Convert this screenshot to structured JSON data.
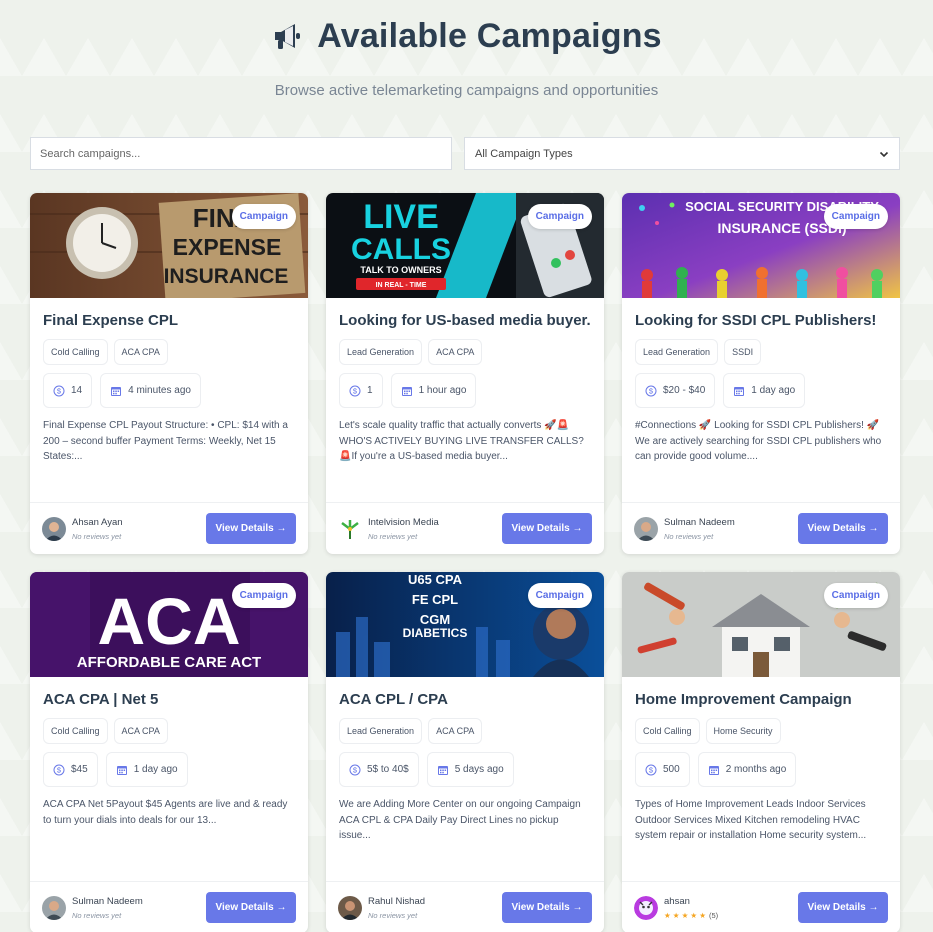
{
  "header": {
    "title": "Available Campaigns",
    "subtitle": "Browse active telemarketing campaigns and opportunities"
  },
  "filters": {
    "search_placeholder": "Search campaigns...",
    "type_selected": "All Campaign Types"
  },
  "colors": {
    "accent": "#6878e8",
    "title": "#2c3e50"
  },
  "campaigns": [
    {
      "badge": "Campaign",
      "banner_text": [
        "FINAL",
        "EXPENSE",
        "INSURANCE"
      ],
      "title": "Final Expense CPL",
      "tags": [
        "Cold Calling",
        "ACA CPA"
      ],
      "payout": "14",
      "posted": "4 minutes ago",
      "description": "Final Expense CPL Payout Structure: • CPL: $14 with a 200 – second buffer Payment Terms: Weekly, Net 15 States:...",
      "author": "Ahsan Ayan",
      "reviews": "No reviews yet",
      "button": "View Details →"
    },
    {
      "badge": "Campaign",
      "banner_text": [
        "LIVE",
        "CALLS",
        "TALK TO OWNERS",
        "IN REAL - TIME"
      ],
      "title": "Looking for US-based media buyer.",
      "tags": [
        "Lead Generation",
        "ACA CPA"
      ],
      "payout": "1",
      "posted": "1 hour ago",
      "description": "Let's scale quality traffic that actually converts 🚀🚨 WHO'S ACTIVELY BUYING LIVE TRANSFER CALLS? 🚨If you're a US-based media buyer...",
      "author": "Intelvision Media",
      "reviews": "No reviews yet",
      "button": "View Details →"
    },
    {
      "badge": "Campaign",
      "banner_text": [
        "SOCIAL SECURITY DISABILITY",
        "INSURANCE (SSDI)"
      ],
      "title": "Looking for SSDI CPL Publishers!",
      "tags": [
        "Lead Generation",
        "SSDI"
      ],
      "payout": "$20 - $40",
      "posted": "1 day ago",
      "description": "#Connections 🚀 Looking for SSDI CPL Publishers! 🚀 We are actively searching for SSDI CPL publishers who can provide good volume....",
      "author": "Sulman Nadeem",
      "reviews": "No reviews yet",
      "button": "View Details →"
    },
    {
      "badge": "Campaign",
      "banner_text": [
        "ACA",
        "AFFORDABLE CARE ACT"
      ],
      "title": "ACA CPA | Net 5",
      "tags": [
        "Cold Calling",
        "ACA CPA"
      ],
      "payout": "$45",
      "posted": "1 day ago",
      "description": "ACA CPA Net 5Payout $45 Agents are live and & ready to turn your dials into deals for our 13...",
      "author": "Sulman Nadeem",
      "reviews": "No reviews yet",
      "button": "View Details →"
    },
    {
      "badge": "Campaign",
      "banner_text": [
        "U65 CPA",
        "FE CPL",
        "CGM",
        "DIABETICS"
      ],
      "title": "ACA CPL / CPA",
      "tags": [
        "Lead Generation",
        "ACA CPA"
      ],
      "payout": "5$ to 40$",
      "posted": "5 days ago",
      "description": "We are Adding More Center on our ongoing Campaign ACA CPL & CPA Daily Pay Direct Lines no pickup issue...",
      "author": "Rahul Nishad",
      "reviews": "No reviews yet",
      "button": "View Details →"
    },
    {
      "badge": "Campaign",
      "banner_text": [],
      "title": "Home Improvement Campaign",
      "tags": [
        "Cold Calling",
        "Home Security"
      ],
      "payout": "500",
      "posted": "2 months ago",
      "description": "Types of Home Improvement Leads Indoor Services Outdoor Services Mixed Kitchen remodeling HVAC system repair or installation Home security system...",
      "author": "ahsan",
      "rating": 5,
      "rating_stars": "★ ★ ★ ★ ★",
      "rating_count": "(5)",
      "button": "View Details →"
    }
  ]
}
